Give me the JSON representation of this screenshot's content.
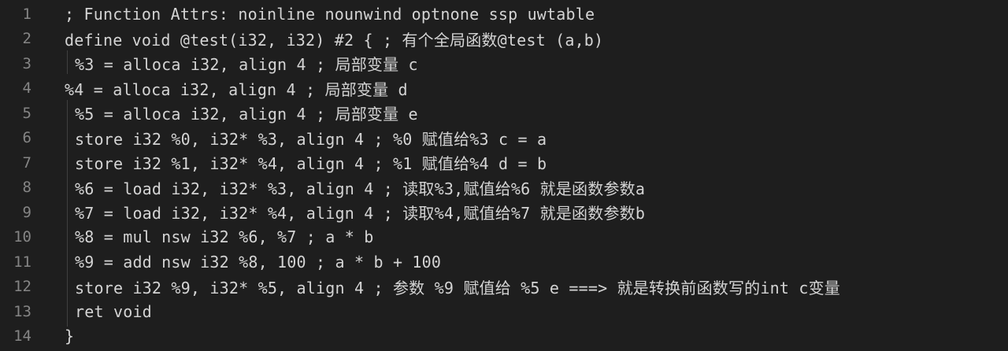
{
  "editor": {
    "lines": [
      {
        "number": "1",
        "text": "; Function Attrs: noinline nounwind optnone ssp uwtable"
      },
      {
        "number": "2",
        "text": "define void @test(i32, i32) #2 { ; 有个全局函数@test (a,b)"
      },
      {
        "number": "3",
        "text": "%3 = alloca i32, align 4 ; 局部变量 c"
      },
      {
        "number": "4",
        "text": "%4 = alloca i32, align 4 ; 局部变量 d"
      },
      {
        "number": "5",
        "text": "%5 = alloca i32, align 4 ; 局部变量 e"
      },
      {
        "number": "6",
        "text": "store i32 %0, i32* %3, align 4 ; %0 赋值给%3 c = a"
      },
      {
        "number": "7",
        "text": "store i32 %1, i32* %4, align 4 ; %1 赋值给%4 d = b"
      },
      {
        "number": "8",
        "text": "%6 = load i32, i32* %3, align 4 ; 读取%3,赋值给%6 就是函数参数a"
      },
      {
        "number": "9",
        "text": "%7 = load i32, i32* %4, align 4 ; 读取%4,赋值给%7 就是函数参数b"
      },
      {
        "number": "10",
        "text": "%8 = mul nsw i32 %6, %7 ; a * b"
      },
      {
        "number": "11",
        "text": "%9 = add nsw i32 %8, 100 ; a * b + 100"
      },
      {
        "number": "12",
        "text": "store i32 %9, i32* %5, align 4 ; 参数 %9 赋值给 %5 e ===> 就是转换前函数写的int c变量"
      },
      {
        "number": "13",
        "text": "ret void"
      },
      {
        "number": "14",
        "text": "}"
      }
    ]
  }
}
